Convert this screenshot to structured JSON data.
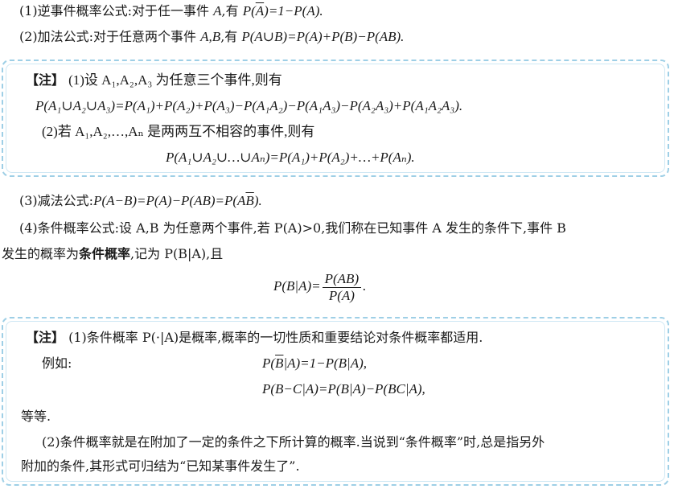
{
  "item1": {
    "prefix": "(1)逆事件概率公式:对于任一事件 ",
    "A": "A",
    "mid": ",有 ",
    "formula_a": "P(",
    "formula_abar": "A",
    "formula_b": ")=1−P(A)."
  },
  "item2": {
    "prefix": "(2)加法公式:对于任意两个事件 ",
    "vars": "A,B",
    "mid": ",有 ",
    "formula": "P(A∪B)=P(A)+P(B)−P(AB)."
  },
  "note1": {
    "tag": "【注】",
    "line1": "(1)设 A₁,A₂,A₃ 为任意三个事件,则有",
    "line2": "P(A₁∪A₂∪A₃)=P(A₁)+P(A₂)+P(A₃)−P(A₁A₂)−P(A₁A₃)−P(A₂A₃)+P(A₁A₂A₃).",
    "line3": "(2)若 A₁,A₂,…,Aₙ 是两两互不相容的事件,则有",
    "line4": "P(A₁∪A₂∪…∪Aₙ)=P(A₁)+P(A₂)+…+P(Aₙ)."
  },
  "item3": {
    "prefix": "(3)减法公式:",
    "formula_a": "P(A−B)=P(A)−P(AB)=P(A",
    "formula_bbar": "B",
    "formula_b": ")."
  },
  "item4": {
    "line1": "(4)条件概率公式:设 A,B 为任意两个事件,若 P(A)>0,我们称在已知事件 A 发生的条件下,事件 B",
    "line2_prefix": "发生的概率为",
    "line2_bold": "条件概率",
    "line2_suffix": ",记为 P(B|A),且",
    "formula_lhs": "P(B|A)=",
    "frac_num": "P(AB)",
    "frac_den": "P(A)",
    "formula_end": "."
  },
  "note2": {
    "tag": "【注】",
    "line1": "(1)条件概率 P(·|A)是概率,概率的一切性质和重要结论对条件概率都适用.",
    "example_label": "例如:",
    "ex1_a": "P(",
    "ex1_bbar": "B",
    "ex1_b": "|A)=1−P(B|A),",
    "ex2": "P(B−C|A)=P(B|A)−P(BC|A),",
    "etc": "等等.",
    "line2": "(2)条件概率就是在附加了一定的条件之下所计算的概率.当说到“条件概率”时,总是指另外",
    "line3": "附加的条件,其形式可归结为“已知某事件发生了”."
  }
}
